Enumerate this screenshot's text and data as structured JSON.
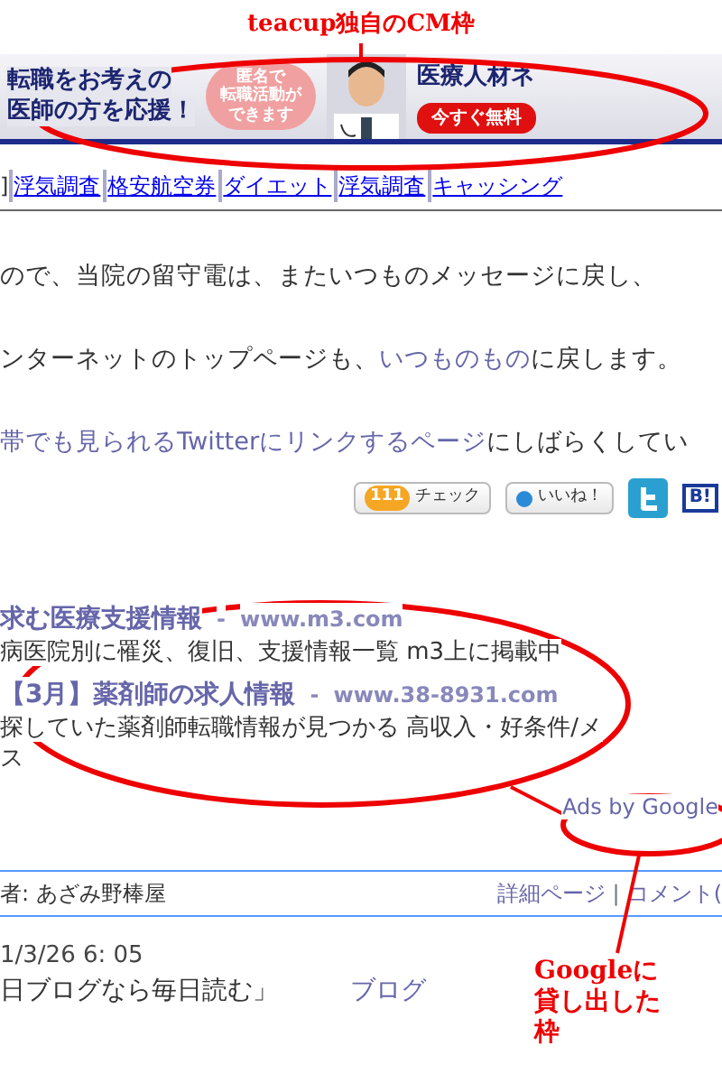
{
  "annotations": [
    {
      "text": "teacup独自のCM枠"
    },
    {
      "text": "Googleに貸し出した枠"
    }
  ],
  "banner": {
    "headline": [
      "転職をお考えの",
      "医師の方を応援！"
    ],
    "bubble": [
      "匿名で",
      "転職活動が",
      "できます"
    ],
    "brand": "医療人材ネ",
    "cta": "今すぐ無料"
  },
  "link_bar": {
    "prefix": "]",
    "links": [
      "浮気調査",
      "格安航空券",
      "ダイエット",
      "浮気調査",
      "キャッシング"
    ]
  },
  "paragraphs": [
    [
      {
        "text": "ので、当院の留守電は、またいつものメッセージに戻し、",
        "link": false
      }
    ],
    [
      {
        "text": "ンターネットのトップページも、",
        "link": false
      },
      {
        "text": "いつものもの",
        "link": true
      },
      {
        "text": "に戻します。",
        "link": false
      }
    ],
    [
      {
        "text": "帯でも見られるTwitterにリンクするページ",
        "link": true
      },
      {
        "text": "にしばらくしてい",
        "link": false
      }
    ]
  ],
  "share": {
    "check_count": "111",
    "check_label": "チェック",
    "like_label": "いいね！",
    "hatena": "B!"
  },
  "ads": [
    {
      "title": "求む医療支援情報",
      "dash": "-",
      "url": "www.m3.com",
      "description": [
        "病医院別に罹災、復旧、支援情報一覧 m3上に掲載中"
      ]
    },
    {
      "title": "【3月】薬剤師の求人情報",
      "dash": "-",
      "url": "www.38-8931.com",
      "description": [
        "探していた薬剤師転職情報が見つかる 高収入・好条件/メ",
        "ス"
      ]
    }
  ],
  "ads_by": "Ads by Google",
  "entry_bar": {
    "author": "者: あざみ野棒屋",
    "detail_link": "詳細ページ",
    "separator": "|",
    "comment_link": "コメント("
  },
  "post": {
    "date": "1/3/26  6: 05",
    "title": "日ブログなら毎日読む」",
    "category": "ブログ"
  }
}
